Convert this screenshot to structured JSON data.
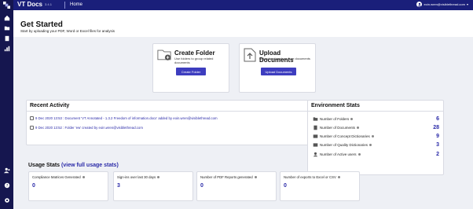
{
  "topbar": {
    "brand": "VT Docs",
    "version": "3.4.1",
    "home": "Home",
    "user_email": "eoin.wren@visiblethread.com",
    "colors": {
      "bar": "#1a1f7a",
      "sidebar": "#15164f"
    }
  },
  "sidebar": {
    "icons": [
      "home-icon",
      "folder-icon",
      "document-icon",
      "chart-icon",
      "users-icon",
      "help-icon",
      "settings-icon"
    ]
  },
  "header": {
    "title": "Get Started",
    "subtitle": "Start by uploading your PDF, Word or Excel files for analysis"
  },
  "create_folder": {
    "title": "Create Folder",
    "description": "Use folders to group related documents",
    "button": "Create Folder"
  },
  "upload_documents": {
    "title": "Upload Documents",
    "description": "Upload and analyze your documents",
    "button": "Upload Documents"
  },
  "recent_activity": {
    "title": "Recent Activity",
    "items": [
      {
        "text": "9 Dec 2020 13:53 : Document 'VT Annotated - 1.3.2 Freedom of information.docx' added by eoin.wren@visiblethread.com"
      },
      {
        "text": "9 Dec 2020 13:52 : Folder 'ew' created by eoin.wren@visiblethread.com"
      }
    ]
  },
  "environment_stats": {
    "title": "Environment Stats",
    "rows": [
      {
        "label": "Number of Folders",
        "value": "6"
      },
      {
        "label": "Number of Documents",
        "value": "28"
      },
      {
        "label": "Number of Concept Dictionaries",
        "value": "9"
      },
      {
        "label": "Number of Quality Dictionaries",
        "value": "3"
      },
      {
        "label": "Number of Active users",
        "value": "2"
      }
    ]
  },
  "usage_stats": {
    "title": "Usage Stats",
    "link": "(view full usage stats)",
    "cards": [
      {
        "label": "Compliance Matrices Generated",
        "value": "0"
      },
      {
        "label": "Sign-ins over last 30 days",
        "value": "3"
      },
      {
        "label": "Number of PDF Reports generated",
        "value": "0"
      },
      {
        "label": "Number of exports to Excel or CSV",
        "value": "0"
      }
    ]
  }
}
